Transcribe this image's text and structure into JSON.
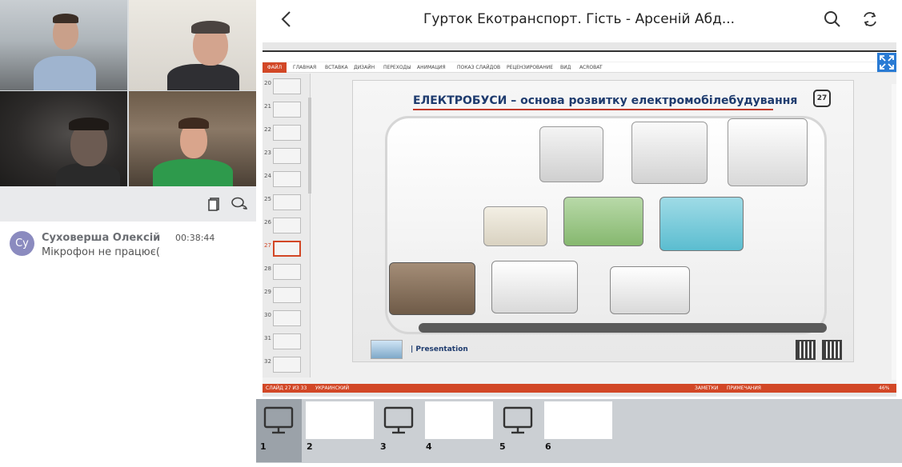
{
  "header": {
    "title": "Гурток Екотранспорт. Гість - Арсеній Абд..."
  },
  "chat": {
    "messages": [
      {
        "avatar_initials": "Су",
        "author": "Суховерша Олексій",
        "time": "00:38:44",
        "text": "Мікрофон не працює("
      }
    ]
  },
  "presentation": {
    "ribbon_tabs": [
      "ФАЙЛ",
      "ГЛАВНАЯ",
      "ВСТАВКА",
      "ДИЗАЙН",
      "ПЕРЕХОДЫ",
      "АНИМАЦИЯ",
      "ПОКАЗ СЛАЙДОВ",
      "РЕЦЕНЗИРОВАНИЕ",
      "ВИД",
      "ACROBAT"
    ],
    "thumbnail_numbers": [
      "20",
      "21",
      "22",
      "23",
      "24",
      "25",
      "26",
      "27",
      "28",
      "29",
      "30",
      "31",
      "32"
    ],
    "selected_thumbnail": "27",
    "status_left": "СЛАЙД 27 ИЗ 33",
    "status_lang": "УКРАИНСКИЙ",
    "status_notes": "ЗАМЕТКИ",
    "status_comments": "ПРИМЕЧАНИЯ",
    "zoom": "46%",
    "slide": {
      "title": "ЕЛЕКТРОБУСИ – основа розвитку електромобілебудування",
      "number": "27",
      "footer_text": "| Presentation"
    }
  },
  "pages": [
    {
      "num": "1",
      "type": "monitor",
      "active": true
    },
    {
      "num": "2",
      "type": "blank",
      "active": false
    },
    {
      "num": "3",
      "type": "monitor",
      "active": false
    },
    {
      "num": "4",
      "type": "blank",
      "active": false
    },
    {
      "num": "5",
      "type": "monitor",
      "active": false
    },
    {
      "num": "6",
      "type": "blank",
      "active": false
    }
  ],
  "colors": {
    "accent_blue": "#2a7bd4",
    "ppt_orange": "#d24726",
    "avatar": "#8b8bbf"
  },
  "icons": [
    "back-icon",
    "search-icon",
    "swap-icon",
    "expand-icon",
    "clipboard-icon",
    "chat-bubbles-icon",
    "monitor-icon"
  ]
}
